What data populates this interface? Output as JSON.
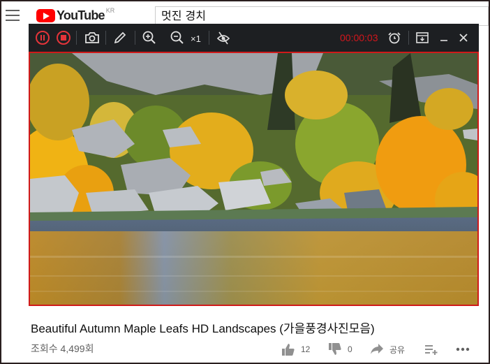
{
  "masthead": {
    "logo_text": "YouTube",
    "region": "KR",
    "search_value": "멋진 경치"
  },
  "recorder": {
    "timer": "00:00:03",
    "speed": "×1",
    "icons": [
      "pause-icon",
      "stop-icon",
      "camera-icon",
      "pencil-icon",
      "zoom-in-icon",
      "zoom-out-icon",
      "hide-icon",
      "alarm-clock-icon",
      "download-icon",
      "minimize-icon",
      "close-icon"
    ],
    "accent": "#d4161c"
  },
  "video": {
    "title": "Beautiful Autumn Maple Leafs HD Landscapes (가을풍경사진모음)",
    "views": "조회수 4,499회",
    "likes": "12",
    "dislikes": "0",
    "share_label": "공유"
  }
}
